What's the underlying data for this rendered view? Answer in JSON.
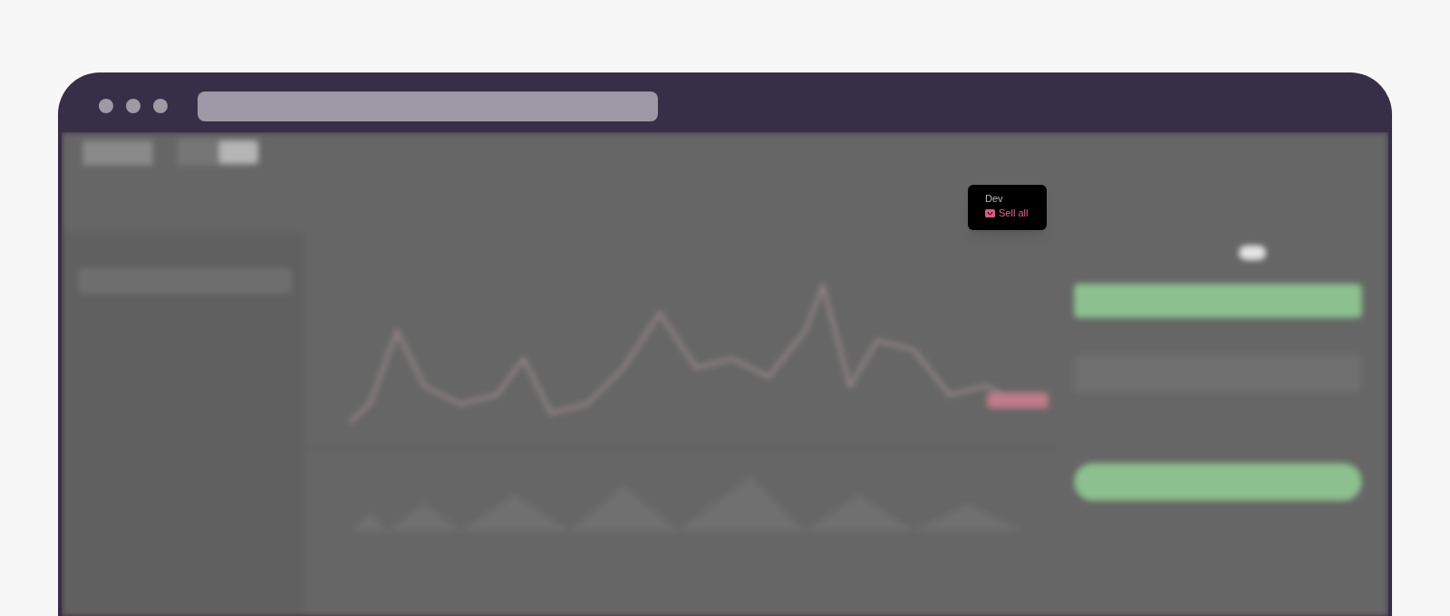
{
  "tooltip": {
    "title": "Dev",
    "action": "Sell all"
  }
}
